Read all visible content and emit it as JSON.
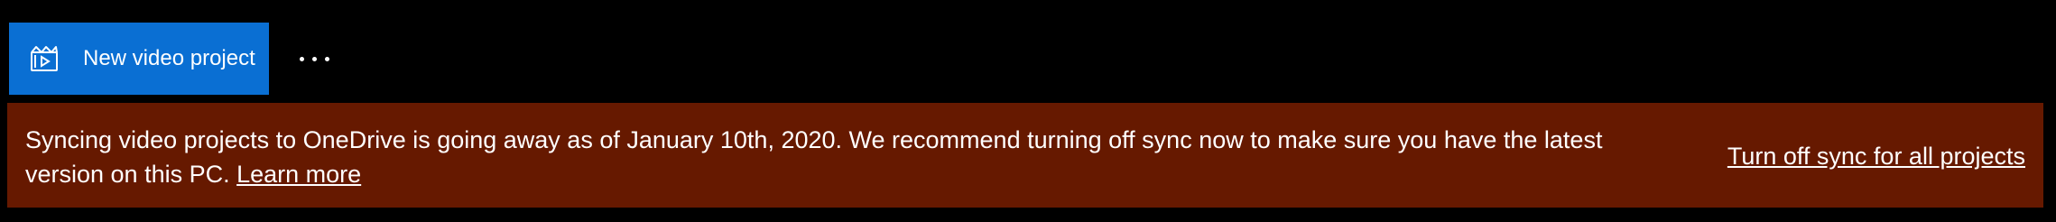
{
  "toolbar": {
    "new_project_label": "New video project",
    "new_project_icon": "film-add-icon",
    "more_icon": "more-ellipsis-icon",
    "accent_color": "#0a6fd3"
  },
  "banner": {
    "message": "Syncing video projects to OneDrive is going away as of January 10th, 2020. We recommend turning off sync now to make sure you have the latest version on this PC.",
    "learn_more": "Learn more",
    "action": "Turn off sync for all projects",
    "background_color": "#661900"
  }
}
